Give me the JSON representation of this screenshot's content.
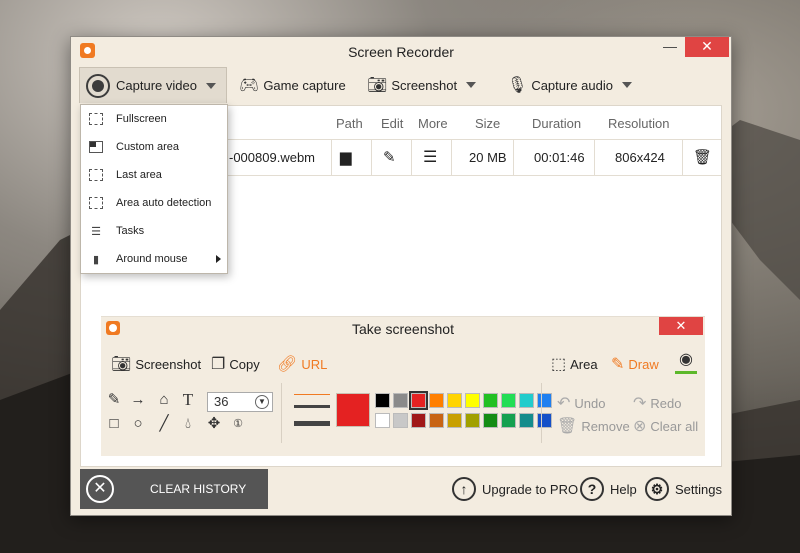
{
  "window": {
    "title": "Screen Recorder",
    "minimize": "—",
    "close": "✕"
  },
  "toolbar": {
    "capture_video": "Capture video",
    "game_capture": "Game capture",
    "screenshot": "Screenshot",
    "capture_audio": "Capture audio"
  },
  "table": {
    "headers": {
      "path": "Path",
      "edit": "Edit",
      "more": "More",
      "size": "Size",
      "duration": "Duration",
      "resolution": "Resolution"
    },
    "rows": [
      {
        "filename": "-000809.webm",
        "size": "20 MB",
        "duration": "00:01:46",
        "resolution": "806x424"
      }
    ]
  },
  "dropdown": {
    "items": [
      {
        "label": "Fullscreen",
        "icon": "fullscreen-icon"
      },
      {
        "label": "Custom area",
        "icon": "custom-area-icon"
      },
      {
        "label": "Last area",
        "icon": "last-area-icon"
      },
      {
        "label": "Area auto detection",
        "icon": "auto-detect-icon"
      },
      {
        "label": "Tasks",
        "icon": "tasks-icon"
      },
      {
        "label": "Around mouse",
        "icon": "mouse-icon"
      }
    ]
  },
  "screenshot_panel": {
    "title": "Take screenshot",
    "close": "✕",
    "actions": {
      "screenshot": "Screenshot",
      "copy": "Copy",
      "url": "URL",
      "area": "Area",
      "draw": "Draw"
    },
    "font_size": "36",
    "main_color": "#e42222",
    "palette_top": [
      "#000000",
      "#8a8a8a",
      "#e42222",
      "#ff7f00",
      "#ffd400",
      "#ffff00",
      "#22c022",
      "#22dd55",
      "#22cccc",
      "#1e7ff0"
    ],
    "palette_bottom": [
      "#ffffff",
      "#c8c8c8",
      "#a01818",
      "#c86414",
      "#c8a000",
      "#a0a000",
      "#148c14",
      "#14a050",
      "#148c8c",
      "#1450c8"
    ],
    "undo": "Undo",
    "redo": "Redo",
    "remove": "Remove",
    "clear_all": "Clear all"
  },
  "footer": {
    "clear_history": "CLEAR HISTORY",
    "upgrade": "Upgrade to PRO",
    "help": "Help",
    "settings": "Settings"
  }
}
